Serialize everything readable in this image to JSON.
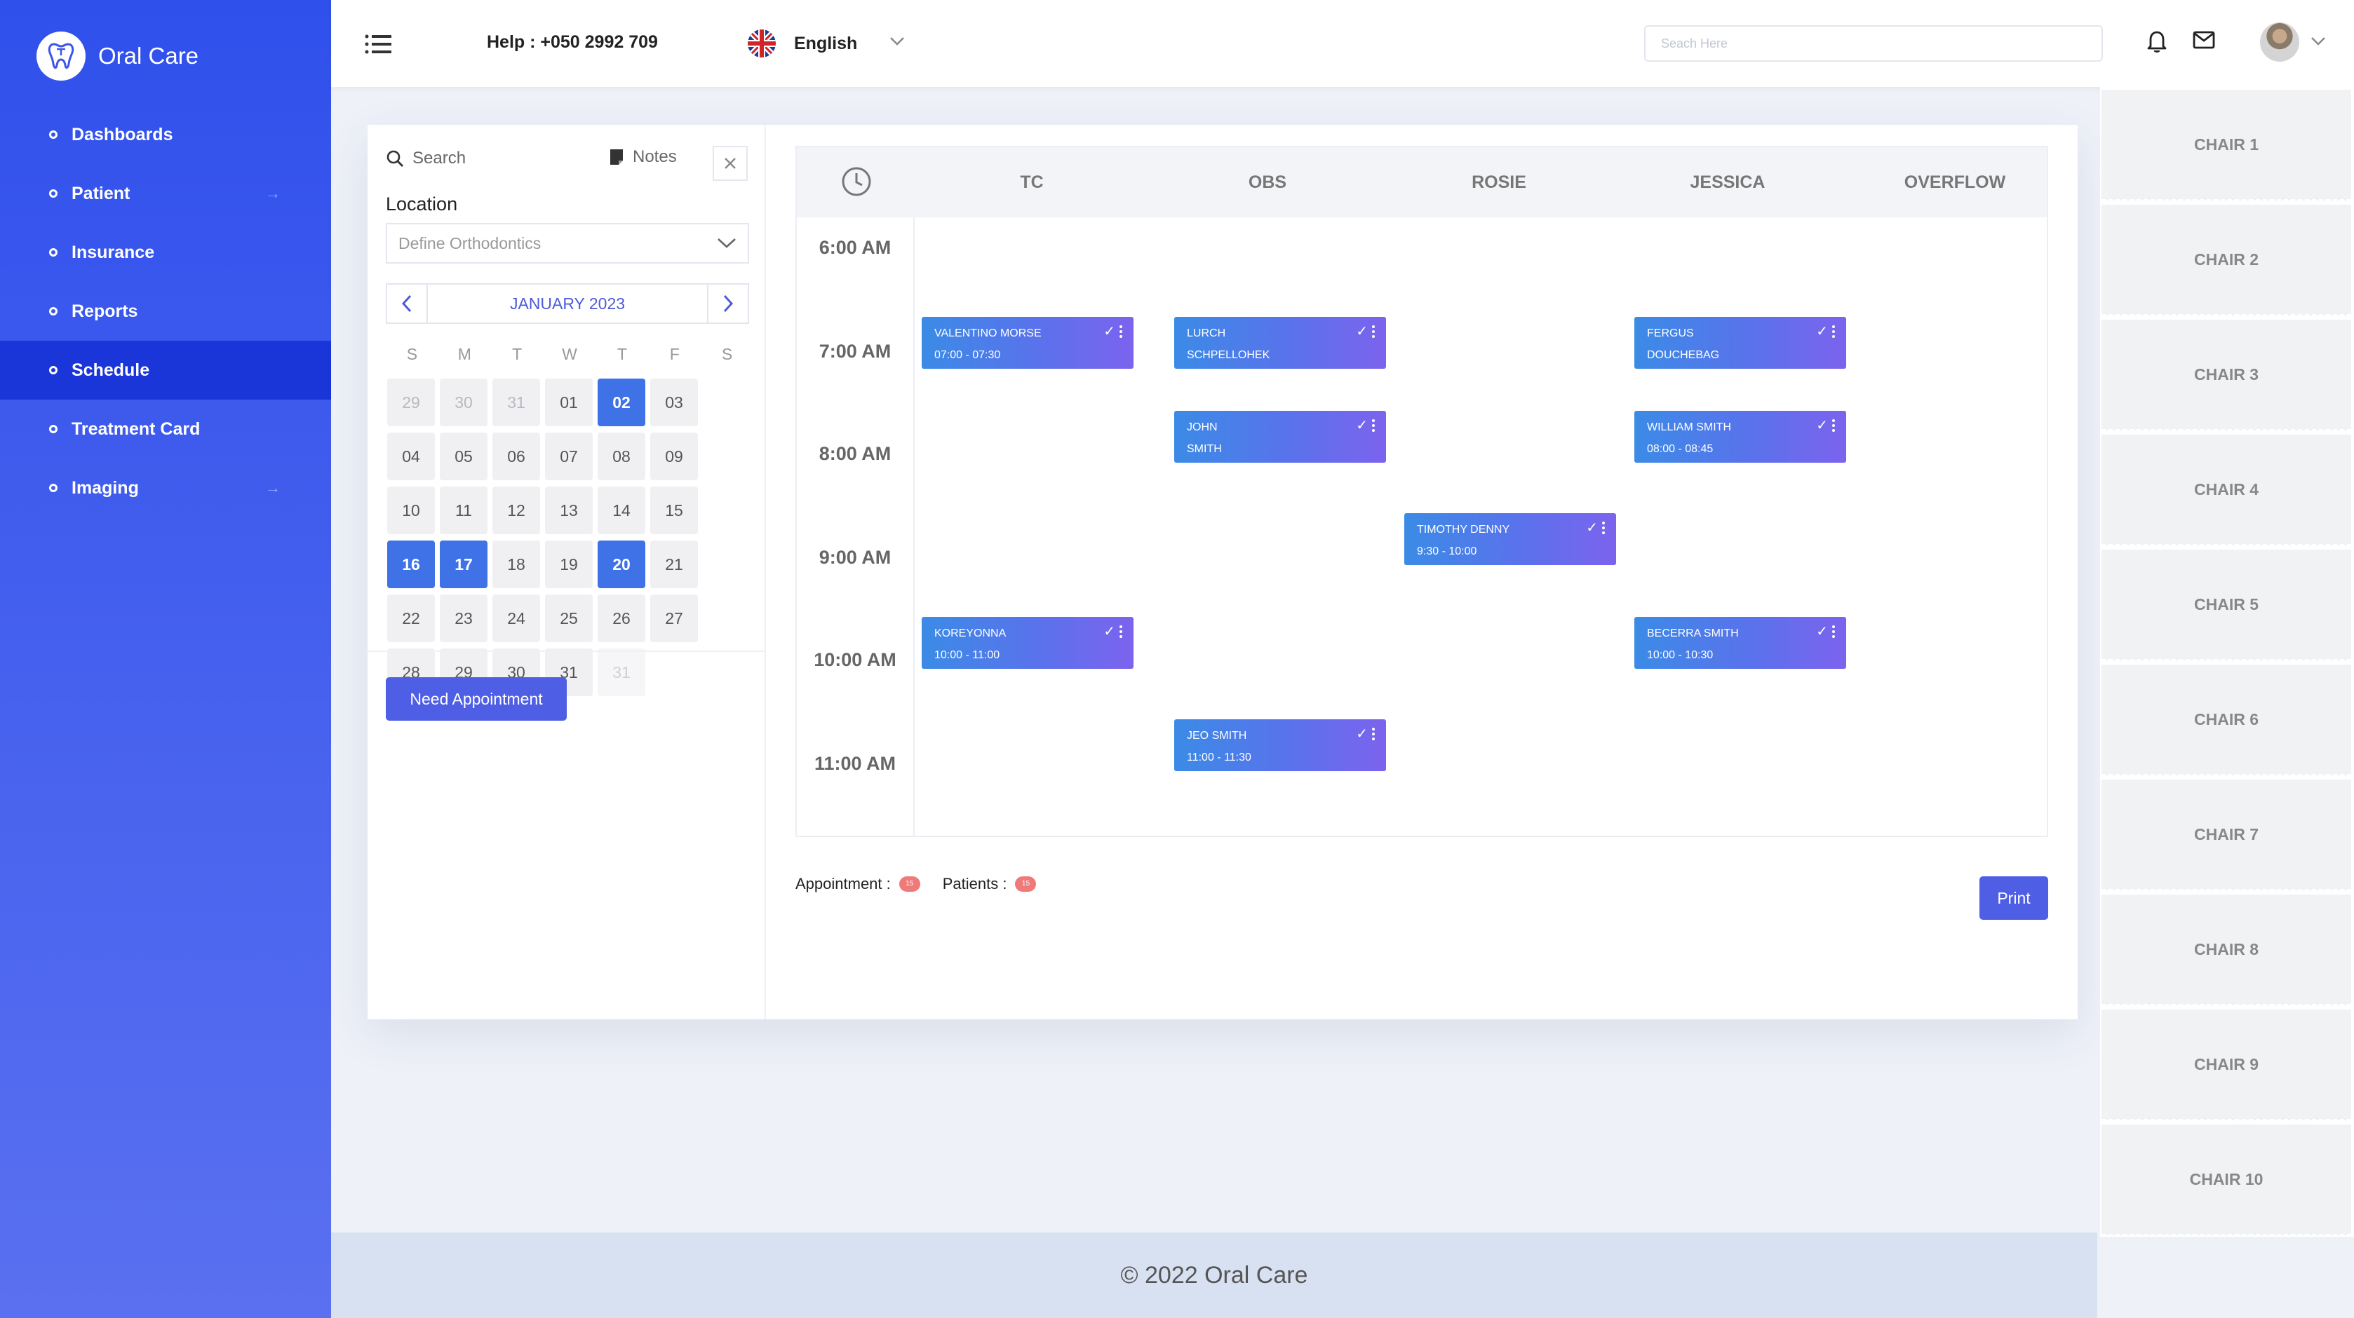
{
  "brand": {
    "name": "Oral Care"
  },
  "sidebar": {
    "items": [
      {
        "label": "Dashboards",
        "arrow": false,
        "active": false
      },
      {
        "label": "Patient",
        "arrow": true,
        "active": false
      },
      {
        "label": "Insurance",
        "arrow": false,
        "active": false
      },
      {
        "label": "Reports",
        "arrow": false,
        "active": false
      },
      {
        "label": "Schedule",
        "arrow": false,
        "active": true
      },
      {
        "label": "Treatment Card",
        "arrow": false,
        "active": false
      },
      {
        "label": "Imaging",
        "arrow": true,
        "active": false
      }
    ]
  },
  "topbar": {
    "help": "Help : +050 2992 709",
    "language": "English",
    "search_placeholder": "Seach Here",
    "icons": [
      "menu-icon",
      "uk-flag-icon",
      "chevron-down-icon",
      "bell-icon",
      "mail-icon",
      "avatar"
    ]
  },
  "left_panel": {
    "search_label": "Search",
    "notes_label": "Notes",
    "location_label": "Location",
    "location_value": "Define Orthodontics",
    "calendar": {
      "month_label": "JANUARY 2023",
      "weekdays": [
        "S",
        "M",
        "T",
        "W",
        "T",
        "F",
        "S"
      ],
      "days": [
        {
          "label": "29",
          "state": "muted"
        },
        {
          "label": "30",
          "state": "muted"
        },
        {
          "label": "31",
          "state": "muted"
        },
        {
          "label": "01",
          "state": ""
        },
        {
          "label": "02",
          "state": "sel"
        },
        {
          "label": "03",
          "state": ""
        },
        {
          "label": "04",
          "state": ""
        },
        {
          "label": "05",
          "state": ""
        },
        {
          "label": "06",
          "state": ""
        },
        {
          "label": "07",
          "state": ""
        },
        {
          "label": "08",
          "state": ""
        },
        {
          "label": "09",
          "state": ""
        },
        {
          "label": "10",
          "state": ""
        },
        {
          "label": "11",
          "state": ""
        },
        {
          "label": "12",
          "state": ""
        },
        {
          "label": "13",
          "state": ""
        },
        {
          "label": "14",
          "state": ""
        },
        {
          "label": "15",
          "state": ""
        },
        {
          "label": "16",
          "state": "sel"
        },
        {
          "label": "17",
          "state": "sel"
        },
        {
          "label": "18",
          "state": ""
        },
        {
          "label": "19",
          "state": ""
        },
        {
          "label": "20",
          "state": "sel"
        },
        {
          "label": "21",
          "state": ""
        },
        {
          "label": "22",
          "state": ""
        },
        {
          "label": "23",
          "state": ""
        },
        {
          "label": "24",
          "state": ""
        },
        {
          "label": "25",
          "state": ""
        },
        {
          "label": "26",
          "state": ""
        },
        {
          "label": "27",
          "state": ""
        },
        {
          "label": "28",
          "state": ""
        },
        {
          "label": "29",
          "state": ""
        },
        {
          "label": "30",
          "state": ""
        },
        {
          "label": "31",
          "state": ""
        },
        {
          "label": "31",
          "state": "faint"
        }
      ]
    },
    "need_appointment_label": "Need Appointment"
  },
  "schedule": {
    "columns": [
      "TC",
      "OBS",
      "ROSIE",
      "JESSICA",
      "OVERFLOW"
    ],
    "times": [
      "6:00 AM",
      "7:00 AM",
      "8:00 AM",
      "9:00 AM",
      "10:00 AM",
      "11:00 AM"
    ],
    "appointments": [
      {
        "column": "TC",
        "slot": "7:00 AM",
        "line1": "VALENTINO MORSE",
        "line2": "07:00 - 07:30"
      },
      {
        "column": "OBS",
        "slot": "7:00 AM",
        "line1": "LURCH",
        "line2": "SCHPELLOHEK"
      },
      {
        "column": "JESSICA",
        "slot": "7:00 AM",
        "line1": "FERGUS",
        "line2": "DOUCHEBAG"
      },
      {
        "column": "OBS",
        "slot": "8:00 AM",
        "line1": "JOHN",
        "line2": "SMITH"
      },
      {
        "column": "JESSICA",
        "slot": "8:00 AM",
        "line1": "WILLIAM SMITH",
        "line2": "08:00 - 08:45"
      },
      {
        "column": "ROSIE",
        "slot": "9:00 AM",
        "line1": "TIMOTHY DENNY",
        "line2": "9:30 - 10:00"
      },
      {
        "column": "TC",
        "slot": "10:00 AM",
        "line1": "KOREYONNA",
        "line2": "10:00 - 11:00"
      },
      {
        "column": "JESSICA",
        "slot": "10:00 AM",
        "line1": "BECERRA SMITH",
        "line2": "10:00 - 10:30"
      },
      {
        "column": "OBS",
        "slot": "11:00 AM",
        "line1": "JEO SMITH",
        "line2": "11:00 - 11:30"
      }
    ]
  },
  "stats": {
    "appointment_label": "Appointment :",
    "appointment_count": "15",
    "patients_label": "Patients :",
    "patients_count": "15"
  },
  "print_label": "Print",
  "footer": {
    "text": "© 2022 Oral Care"
  },
  "chairs": [
    "CHAIR 1",
    "CHAIR 2",
    "CHAIR 3",
    "CHAIR 4",
    "CHAIR 5",
    "CHAIR 6",
    "CHAIR 7",
    "CHAIR 8",
    "CHAIR 9",
    "CHAIR 10"
  ]
}
